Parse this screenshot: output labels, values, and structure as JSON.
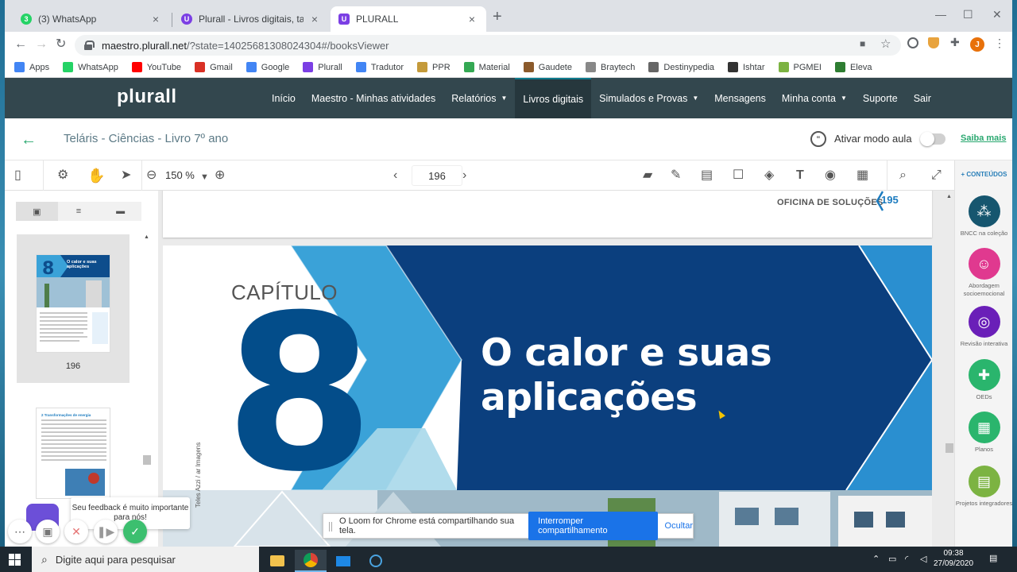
{
  "browser": {
    "tabs": [
      {
        "title": "(3) WhatsApp",
        "favicon_color": "#25d366",
        "badge": "3"
      },
      {
        "title": "Plurall - Livros digitais, tarefas, tu",
        "favicon_color": "#7b3fe4"
      },
      {
        "title": "PLURALL",
        "favicon_color": "#7b3fe4"
      }
    ],
    "url_host": "maestro.plurall.net",
    "url_path": "/?state=14025681308024304#/booksViewer",
    "profile_initial": "J",
    "bookmarks": [
      {
        "label": "Apps",
        "icon": "apps-grid-icon",
        "color": "#4285f4"
      },
      {
        "label": "WhatsApp",
        "icon": "whatsapp-icon",
        "color": "#25d366"
      },
      {
        "label": "YouTube",
        "icon": "youtube-icon",
        "color": "#ff0000"
      },
      {
        "label": "Gmail",
        "icon": "gmail-icon",
        "color": "#d93025"
      },
      {
        "label": "Google",
        "icon": "google-icon",
        "color": "#4285f4"
      },
      {
        "label": "Plurall",
        "icon": "plurall-icon",
        "color": "#7b3fe4"
      },
      {
        "label": "Tradutor",
        "icon": "translate-icon",
        "color": "#4285f4"
      },
      {
        "label": "PPR",
        "icon": "ppr-icon",
        "color": "#c49a3a"
      },
      {
        "label": "Material",
        "icon": "drive-icon",
        "color": "#34a853"
      },
      {
        "label": "Gaudete",
        "icon": "gaudete-icon",
        "color": "#8b5a2b"
      },
      {
        "label": "Braytech",
        "icon": "braytech-icon",
        "color": "#888888"
      },
      {
        "label": "Destinypedia",
        "icon": "destinypedia-icon",
        "color": "#666666"
      },
      {
        "label": "Ishtar",
        "icon": "ishtar-icon",
        "color": "#333333"
      },
      {
        "label": "PGMEI",
        "icon": "pgmei-icon",
        "color": "#7cb342"
      },
      {
        "label": "Eleva",
        "icon": "eleva-icon",
        "color": "#2e7d32"
      }
    ]
  },
  "plurall": {
    "logo": "plurall",
    "nav": [
      {
        "label": "Início",
        "dropdown": false,
        "active": false
      },
      {
        "label": "Maestro - Minhas atividades",
        "dropdown": false,
        "active": false
      },
      {
        "label": "Relatórios",
        "dropdown": true,
        "active": false
      },
      {
        "label": "Livros digitais",
        "dropdown": false,
        "active": true
      },
      {
        "label": "Simulados e Provas",
        "dropdown": true,
        "active": false
      },
      {
        "label": "Mensagens",
        "dropdown": false,
        "active": false
      },
      {
        "label": "Minha conta",
        "dropdown": true,
        "active": false
      },
      {
        "label": "Suporte",
        "dropdown": false,
        "active": false
      },
      {
        "label": "Sair",
        "dropdown": false,
        "active": false
      }
    ],
    "book_title": "Teláris - Ciências - Livro 7º ano",
    "mode_label": "Ativar modo aula",
    "mode_on": false,
    "saiba_mais": "Saiba mais"
  },
  "viewer": {
    "zoom": "150 %",
    "page": "196",
    "thumbnail_page_label": "196",
    "page_header": "OFICINA DE SOLUÇÕES",
    "page_number": "195",
    "chapter_label": "CAPÍTULO",
    "chapter_number": "8",
    "chapter_title_line1": "O calor e suas",
    "chapter_title_line2": "aplicações",
    "thumb1_title": "O calor e suas aplicações",
    "thumb2_title": "2 Transformações de energia",
    "credit_text": "Teles Azzi / ar Imagens"
  },
  "sidebar_right": {
    "header": "+ CONTEÚDOS",
    "items": [
      {
        "label": "BNCC na coleção",
        "color": "#16566f",
        "icon": "bncc-icon"
      },
      {
        "label": "Abordagem socioemocional",
        "color": "#e0398f",
        "icon": "socioemotional-icon"
      },
      {
        "label": "Revisão interativa",
        "color": "#6a1fb8",
        "icon": "review-icon"
      },
      {
        "label": "OEDs",
        "color": "#2ab56d",
        "icon": "puzzle-icon"
      },
      {
        "label": "Planos",
        "color": "#2ab56d",
        "icon": "calendar-icon"
      },
      {
        "label": "Projetos integradores",
        "color": "#7cb342",
        "icon": "document-icon"
      }
    ]
  },
  "loom": {
    "message": "O Loom for Chrome está compartilhando sua tela.",
    "stop_label": "Interromper compartilhamento",
    "hide_label": "Ocultar"
  },
  "feedback": {
    "message": "Seu feedback é muito importante para nós!"
  },
  "taskbar": {
    "search_placeholder": "Digite aqui para pesquisar",
    "time": "09:38",
    "date": "27/09/2020"
  }
}
